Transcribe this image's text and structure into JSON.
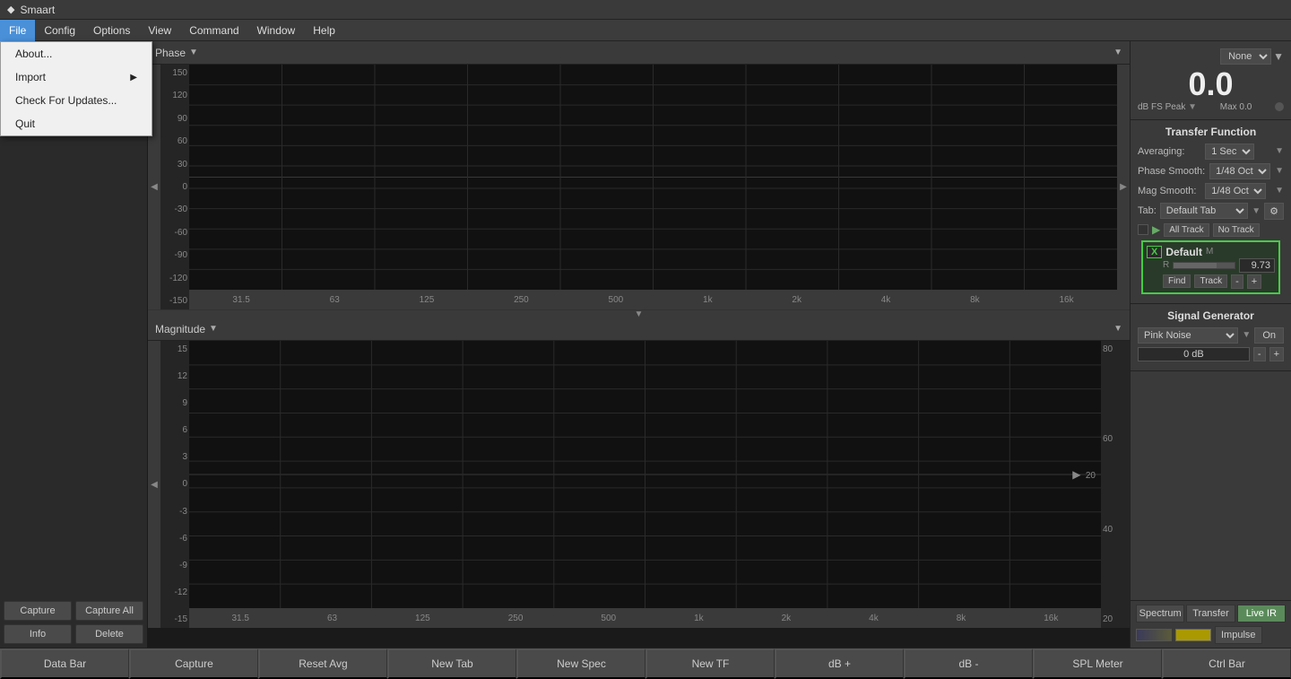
{
  "app": {
    "title": "Smaart"
  },
  "menubar": {
    "items": [
      "File",
      "Config",
      "Options",
      "View",
      "Command",
      "Window",
      "Help"
    ]
  },
  "file_menu": {
    "items": [
      {
        "label": "About...",
        "has_arrow": false
      },
      {
        "label": "Import",
        "has_arrow": true
      },
      {
        "label": "Check For Updates...",
        "has_arrow": false
      },
      {
        "label": "Quit",
        "has_arrow": false
      }
    ]
  },
  "phase_chart": {
    "title": "Phase",
    "y_labels": [
      "150",
      "120",
      "90",
      "60",
      "30",
      "0",
      "-30",
      "-60",
      "-90",
      "-120",
      "-150"
    ],
    "x_labels": [
      "31.5",
      "63",
      "125",
      "250",
      "500",
      "1k",
      "2k",
      "4k",
      "8k",
      "16k"
    ]
  },
  "magnitude_chart": {
    "title": "Magnitude",
    "y_labels": [
      "15",
      "12",
      "9",
      "6",
      "3",
      "0",
      "-3",
      "-6",
      "-9",
      "-12",
      "-15"
    ],
    "y_right_labels": [
      "80",
      "60",
      "40",
      "20"
    ],
    "x_labels": [
      "31.5",
      "63",
      "125",
      "250",
      "500",
      "1k",
      "2k",
      "4k",
      "8k",
      "16k"
    ]
  },
  "level_meter": {
    "source_label": "None",
    "value": "0.0",
    "unit": "dB FS Peak",
    "max_label": "Max 0.0"
  },
  "transfer_function": {
    "title": "Transfer Function",
    "averaging_label": "Averaging:",
    "averaging_value": "1 Sec",
    "phase_smooth_label": "Phase Smooth:",
    "phase_smooth_value": "1/48 Oct",
    "mag_smooth_label": "Mag Smooth:",
    "mag_smooth_value": "1/48 Oct",
    "tab_label": "Tab:",
    "tab_value": "Default Tab",
    "all_track_label": "All Track",
    "no_track_label": "No Track"
  },
  "default_entry": {
    "name": "Default",
    "value": "9.73",
    "m_label": "M",
    "r_label": "R",
    "find_label": "Find",
    "track_label": "Track",
    "minus_label": "-",
    "plus_label": "+"
  },
  "signal_generator": {
    "title": "Signal Generator",
    "type": "Pink Noise",
    "on_label": "On",
    "db_value": "0 dB",
    "minus_label": "-",
    "plus_label": "+"
  },
  "bottom_tabs": {
    "spectrum_label": "Spectrum",
    "transfer_label": "Transfer",
    "live_ir_label": "Live IR",
    "impulse_label": "Impulse"
  },
  "sidebar_buttons": {
    "capture_label": "Capture",
    "capture_all_label": "Capture All",
    "info_label": "Info",
    "delete_label": "Delete"
  },
  "toolbar": {
    "buttons": [
      "Data Bar",
      "Capture",
      "Reset Avg",
      "New Tab",
      "New Spec",
      "New TF",
      "dB +",
      "dB -",
      "SPL Meter",
      "Ctrl Bar"
    ]
  }
}
